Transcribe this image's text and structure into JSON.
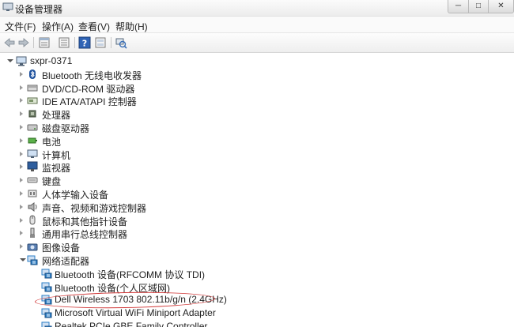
{
  "window": {
    "title": "设备管理器",
    "controls": {
      "minimize": "─",
      "maximize": "□",
      "close": "✕"
    }
  },
  "menu": [
    "文件(F)",
    "操作(A)",
    "查看(V)",
    "帮助(H)"
  ],
  "toolbar": [
    {
      "name": "back-icon",
      "glyph": "⇦"
    },
    {
      "name": "forward-icon",
      "glyph": "⇨"
    },
    {
      "name": "properties-icon"
    },
    {
      "name": "list-icon"
    },
    {
      "name": "help-icon",
      "glyph": "?"
    },
    {
      "name": "view-icon"
    },
    {
      "name": "scan-hardware-icon"
    }
  ],
  "tree": {
    "root": "sxpr-0371",
    "categories": [
      {
        "label": "Bluetooth 无线电收发器",
        "icon": "bluetooth-icon",
        "expanded": false
      },
      {
        "label": "DVD/CD-ROM 驱动器",
        "icon": "cdrom-icon",
        "expanded": false
      },
      {
        "label": "IDE ATA/ATAPI 控制器",
        "icon": "ide-controller-icon",
        "expanded": false
      },
      {
        "label": "处理器",
        "icon": "processor-icon",
        "expanded": false
      },
      {
        "label": "磁盘驱动器",
        "icon": "disk-drive-icon",
        "expanded": false
      },
      {
        "label": "电池",
        "icon": "battery-icon",
        "expanded": false
      },
      {
        "label": "计算机",
        "icon": "computer-icon",
        "expanded": false
      },
      {
        "label": "监视器",
        "icon": "monitor-icon",
        "expanded": false
      },
      {
        "label": "键盘",
        "icon": "keyboard-icon",
        "expanded": false
      },
      {
        "label": "人体学输入设备",
        "icon": "hid-icon",
        "expanded": false
      },
      {
        "label": "声音、视频和游戏控制器",
        "icon": "sound-icon",
        "expanded": false
      },
      {
        "label": "鼠标和其他指针设备",
        "icon": "mouse-icon",
        "expanded": false
      },
      {
        "label": "通用串行总线控制器",
        "icon": "usb-icon",
        "expanded": false
      },
      {
        "label": "图像设备",
        "icon": "camera-icon",
        "expanded": false
      },
      {
        "label": "网络适配器",
        "icon": "network-adapter-icon",
        "expanded": true
      }
    ],
    "network_adapters": [
      {
        "label": "Bluetooth 设备(RFCOMM 协议 TDI)",
        "highlighted": false
      },
      {
        "label": "Bluetooth 设备(个人区域网)",
        "highlighted": false
      },
      {
        "label": "Dell Wireless 1703 802.11b/g/n (2.4GHz)",
        "highlighted": true
      },
      {
        "label": "Microsoft Virtual WiFi Miniport Adapter",
        "highlighted": false
      },
      {
        "label": "Realtek PCIe GBE Family Controller",
        "highlighted": false
      }
    ]
  },
  "colors": {
    "highlight_oval": "#d23a3a",
    "title_bar": "#f2f2f2",
    "network_icon": "#2d7fc7"
  }
}
